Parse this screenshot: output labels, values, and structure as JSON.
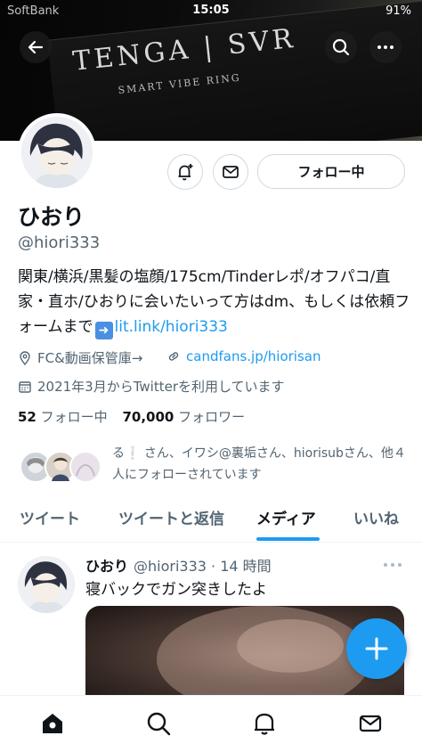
{
  "status_bar": {
    "carrier": "SoftBank",
    "time": "15:05",
    "battery": "91%"
  },
  "banner": {
    "brand": "TENGA | SVR",
    "subtitle": "SMART VIBE RING"
  },
  "profile": {
    "name": "ひおり",
    "handle": "@hiori333",
    "follow_button": "フォロー中",
    "bio_text": "関東/横浜/黒髪の塩顔/175cm/Tinderレポ/オフパコ/直家・直ホ/ひおりに会いたいって方はdm、もしくは依頼フォームまで",
    "bio_link": "lit.link/hiori333",
    "location": "FC&動画保管庫→",
    "website": "candfans.jp/hiorisan",
    "joined": "2021年3月からTwitterを利用しています",
    "following_count": "52",
    "following_label": "フォロー中",
    "followers_count": "70,000",
    "followers_label": "フォロワー",
    "known_followers": "る❕ さん、イワシ@裏垢さん、hiorisubさん、他４人にフォローされています"
  },
  "tabs": [
    {
      "label": "ツイート"
    },
    {
      "label": "ツイートと返信"
    },
    {
      "label": "メディア"
    },
    {
      "label": "いいね"
    }
  ],
  "tweet": {
    "name": "ひおり",
    "handle": "@hiori333",
    "time": "· 14 時間",
    "text": "寝バックでガン突きしたよ"
  },
  "colors": {
    "accent": "#1d9bf0",
    "text": "#0f1419",
    "muted": "#536471"
  },
  "icons": [
    "back-arrow-icon",
    "search-icon",
    "more-icon",
    "bell-plus-icon",
    "mail-icon",
    "location-icon",
    "link-icon",
    "calendar-icon",
    "compose-plus-icon",
    "home-icon",
    "explore-search-icon",
    "notifications-icon",
    "messages-icon"
  ]
}
